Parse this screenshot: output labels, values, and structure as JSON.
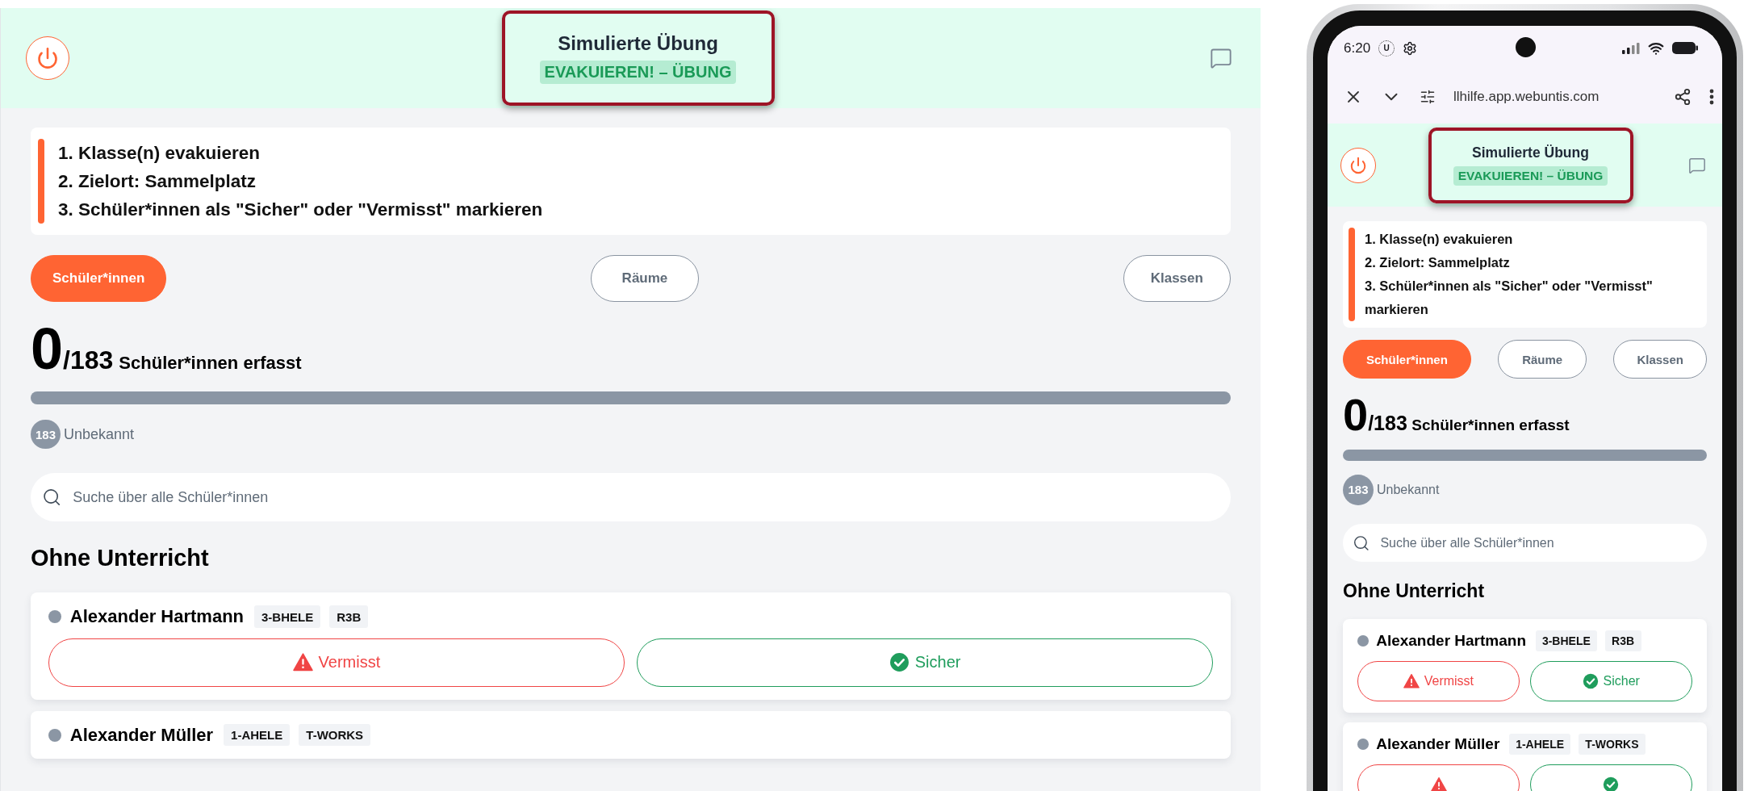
{
  "desktop": {
    "app": {
      "header": {
        "title": "Simulierte Übung",
        "badge": "EVAKUIEREN! – ÜBUNG"
      },
      "instructions": [
        "1. Klasse(n) evakuieren",
        "2. Zielort: Sammelplatz",
        "3. Schüler*innen als \"Sicher\" oder \"Vermisst\" markieren"
      ],
      "tabs": [
        {
          "label": "Schüler*innen",
          "selected": true
        },
        {
          "label": "Räume",
          "selected": false
        },
        {
          "label": "Klassen",
          "selected": false
        }
      ],
      "progress": {
        "count": "0",
        "total": "/183",
        "label": "Schüler*innen erfasst"
      },
      "legend": [
        {
          "count": "183",
          "label": "Unbekannt",
          "color": "#8b96a4"
        }
      ],
      "search": {
        "placeholder": "Suche über alle Schüler*innen"
      },
      "section": {
        "title": "Ohne Unterricht"
      },
      "students": [
        {
          "name": "Alexander Hartmann",
          "color": "#8b96a4",
          "tags": [
            "3-BHELE",
            "R3B"
          ],
          "actions": [
            {
              "kind": "missing",
              "label": "Vermisst"
            },
            {
              "kind": "safe",
              "label": "Sicher"
            }
          ]
        },
        {
          "name": "Alexander Müller",
          "color": "#8b96a4",
          "tags": [
            "1-AHELE",
            "T-WORKS"
          ]
        }
      ]
    }
  },
  "phone": {
    "status_bar": {
      "time": "6:20",
      "notification": "U"
    },
    "browser": {
      "url": "llhilfe.app.webuntis.com"
    },
    "app": {
      "header": {
        "title": "Simulierte Übung",
        "badge": "EVAKUIEREN! – ÜBUNG"
      },
      "instructions": [
        "1. Klasse(n) evakuieren",
        "2. Zielort: Sammelplatz",
        "3. Schüler*innen als \"Sicher\" oder \"Vermisst\" markieren"
      ],
      "tabs": [
        {
          "label": "Schüler*innen",
          "selected": true
        },
        {
          "label": "Räume",
          "selected": false
        },
        {
          "label": "Klassen",
          "selected": false
        }
      ],
      "progress": {
        "count": "0",
        "total": "/183",
        "label": "Schüler*innen erfasst"
      },
      "legend": [
        {
          "count": "183",
          "label": "Unbekannt",
          "color": "#8b96a4"
        }
      ],
      "search": {
        "placeholder": "Suche über alle Schüler*innen"
      },
      "section": {
        "title": "Ohne Unterricht"
      },
      "students": [
        {
          "name": "Alexander Hartmann",
          "color": "#8b96a4",
          "tags": [
            "3-BHELE",
            "R3B"
          ],
          "actions": [
            {
              "kind": "missing",
              "label": "Vermisst"
            },
            {
              "kind": "safe",
              "label": "Sicher"
            }
          ]
        },
        {
          "name": "Alexander Müller",
          "color": "#8b96a4",
          "tags": [
            "1-AHELE",
            "T-WORKS"
          ],
          "actions": [
            {
              "kind": "missing"
            },
            {
              "kind": "safe"
            }
          ]
        }
      ]
    }
  }
}
